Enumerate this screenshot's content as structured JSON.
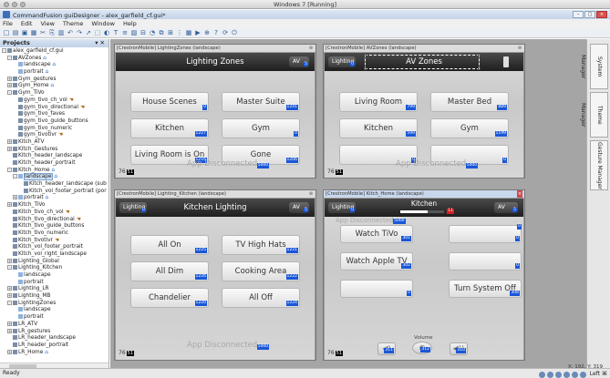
{
  "vm_title": "Windows 7 [Running]",
  "app_title": "CommandFusion guiDesigner - alex_garfield_cf.gui*",
  "menu": [
    "File",
    "Edit",
    "View",
    "Theme",
    "Window",
    "Help"
  ],
  "toolbar_icons": [
    "new",
    "open",
    "save",
    "save-as",
    "cut",
    "copy",
    "paste",
    "undo",
    "redo",
    "pointer",
    "marquee",
    "theme",
    "font",
    "list",
    "image",
    "slider",
    "gauge",
    "arrange",
    "align",
    "distribute",
    "grid",
    "preview",
    "zoom",
    "help",
    "refresh",
    "power"
  ],
  "projects": {
    "header": "Projects",
    "tree": [
      {
        "label": "alex_garfield_cf.gui",
        "indent": 0,
        "ex": "-",
        "icon": "gui"
      },
      {
        "label": "AVZones",
        "indent": 1,
        "ex": "-",
        "icon": "page",
        "badge": "home"
      },
      {
        "label": "landscape",
        "indent": 2,
        "ex": "",
        "icon": "pg",
        "badge": "home"
      },
      {
        "label": "portrait",
        "indent": 2,
        "ex": "",
        "icon": "pg",
        "badge": "home"
      },
      {
        "label": "Gym_gestures",
        "indent": 1,
        "ex": "+",
        "icon": "page"
      },
      {
        "label": "Gym_Home",
        "indent": 1,
        "ex": "+",
        "icon": "page",
        "badge": "home"
      },
      {
        "label": "Gym_TiVo",
        "indent": 1,
        "ex": "-",
        "icon": "page"
      },
      {
        "label": "gym_tivo_ch_vol",
        "indent": 2,
        "ex": "",
        "icon": "sub",
        "badge": "hand"
      },
      {
        "label": "gym_tivo_directional",
        "indent": 2,
        "ex": "",
        "icon": "sub",
        "badge": "hand"
      },
      {
        "label": "gym_tivo_faves",
        "indent": 2,
        "ex": "",
        "icon": "sub"
      },
      {
        "label": "gym_tivo_guide_buttons",
        "indent": 2,
        "ex": "",
        "icon": "sub"
      },
      {
        "label": "gym_tivo_numeric",
        "indent": 2,
        "ex": "",
        "icon": "sub"
      },
      {
        "label": "gym_tivotivr",
        "indent": 2,
        "ex": "",
        "icon": "sub",
        "badge": "hand"
      },
      {
        "label": "Kitch_ATV",
        "indent": 1,
        "ex": "+",
        "icon": "page"
      },
      {
        "label": "Kitch_Gestures",
        "indent": 1,
        "ex": "+",
        "icon": "page"
      },
      {
        "label": "Kitch_header_landscape",
        "indent": 1,
        "ex": "",
        "icon": "sub"
      },
      {
        "label": "Kitch_header_portrait",
        "indent": 1,
        "ex": "",
        "icon": "sub"
      },
      {
        "label": "Kitch_Home",
        "indent": 1,
        "ex": "-",
        "icon": "page",
        "badge": "home"
      },
      {
        "label": "landscape",
        "indent": 2,
        "ex": "-",
        "icon": "pg",
        "badge": "home",
        "selected": true
      },
      {
        "label": "Kitch_header_landscape (sub",
        "indent": 3,
        "ex": "",
        "icon": "sub"
      },
      {
        "label": "Kitch_vol_footer_portrait (por",
        "indent": 3,
        "ex": "",
        "icon": "sub"
      },
      {
        "label": "portrait",
        "indent": 2,
        "ex": "+",
        "icon": "pg",
        "badge": "home"
      },
      {
        "label": "Kitch_TiVo",
        "indent": 1,
        "ex": "+",
        "icon": "page"
      },
      {
        "label": "Kitch_tivo_ch_vol",
        "indent": 1,
        "ex": "",
        "icon": "sub",
        "badge": "hand"
      },
      {
        "label": "Kitch_tivo_directional",
        "indent": 1,
        "ex": "",
        "icon": "sub",
        "badge": "hand"
      },
      {
        "label": "Kitch_tivo_guide_buttons",
        "indent": 1,
        "ex": "",
        "icon": "sub"
      },
      {
        "label": "Kitch_tivo_numeric",
        "indent": 1,
        "ex": "",
        "icon": "sub"
      },
      {
        "label": "Kitch_tivotivr",
        "indent": 1,
        "ex": "",
        "icon": "sub",
        "badge": "hand"
      },
      {
        "label": "Kitch_vol_footer_portrait",
        "indent": 1,
        "ex": "",
        "icon": "sub"
      },
      {
        "label": "Kitch_vol_right_landscape",
        "indent": 1,
        "ex": "",
        "icon": "sub"
      },
      {
        "label": "Lighting_Global",
        "indent": 1,
        "ex": "+",
        "icon": "page"
      },
      {
        "label": "Lighting_Kitchen",
        "indent": 1,
        "ex": "-",
        "icon": "page"
      },
      {
        "label": "landscape",
        "indent": 2,
        "ex": "",
        "icon": "pg"
      },
      {
        "label": "portrait",
        "indent": 2,
        "ex": "",
        "icon": "pg"
      },
      {
        "label": "Lighting_LR",
        "indent": 1,
        "ex": "+",
        "icon": "page"
      },
      {
        "label": "Lighting_MB",
        "indent": 1,
        "ex": "+",
        "icon": "page"
      },
      {
        "label": "LightingZones",
        "indent": 1,
        "ex": "-",
        "icon": "page"
      },
      {
        "label": "landscape",
        "indent": 2,
        "ex": "",
        "icon": "pg"
      },
      {
        "label": "portrait",
        "indent": 2,
        "ex": "",
        "icon": "pg"
      },
      {
        "label": "LR_ATV",
        "indent": 1,
        "ex": "+",
        "icon": "page"
      },
      {
        "label": "LR_gestures",
        "indent": 1,
        "ex": "+",
        "icon": "page"
      },
      {
        "label": "LR_header_landscape",
        "indent": 1,
        "ex": "",
        "icon": "sub"
      },
      {
        "label": "LR_header_portrait",
        "indent": 1,
        "ex": "",
        "icon": "sub"
      },
      {
        "label": "LR_Home",
        "indent": 1,
        "ex": "+",
        "icon": "page",
        "badge": "home"
      }
    ]
  },
  "right_tabs": [
    "System Manager",
    "Theme Manager",
    "Gesture Manager"
  ],
  "panels": {
    "lighting_zones": {
      "title": "[CrestronMobile] LightingZones (landscape)",
      "close": "⊗",
      "header_title": "Lighting Zones",
      "av_pill": "AV",
      "av_join": "5",
      "buttons": [
        {
          "label": "House Scenes",
          "join": "0"
        },
        {
          "label": "Master Suite",
          "join": "1241"
        },
        {
          "label": "Kitchen",
          "join": "1227"
        },
        {
          "label": "Gym",
          "join": "0"
        },
        {
          "label": "Living Room is On",
          "join": "1216"
        },
        {
          "label": "Gone",
          "join": "1206"
        }
      ],
      "footer_text": "App Disconnected",
      "footer_join": "5000",
      "page_num": "76",
      "page_key": "51"
    },
    "av_zones": {
      "title": "[CrestronMobile] AVZones (landscape)",
      "close": "⊗",
      "header_title": "AV Zones",
      "lighting_pill": "Lighting",
      "lighting_join": "0",
      "buttons": [
        {
          "label": "Living Room",
          "join": "799"
        },
        {
          "label": "Master Bed",
          "join": "889"
        },
        {
          "label": "Kitchen",
          "join": "599"
        },
        {
          "label": "Gym",
          "join": "1199"
        },
        {
          "label": "",
          "join": "0"
        },
        {
          "label": "",
          "join": "0"
        }
      ],
      "footer_text": "App Disconnected",
      "footer_join": "5000",
      "page_num": "76",
      "page_key": "51"
    },
    "lighting_kitchen": {
      "title": "[CrestronMobile] Lighting_Kitchen (landscape)",
      "close": "⊗",
      "header_title": "Kitchen Lighting",
      "lighting_pill": "Lighting",
      "lighting_join": "0",
      "av_pill": "AV",
      "av_join": "5",
      "buttons": [
        {
          "label": "All On",
          "join": "1225"
        },
        {
          "label": "TV High Hats",
          "join": "1221"
        },
        {
          "label": "All Dim",
          "join": "1226"
        },
        {
          "label": "Cooking Area",
          "join": "1222"
        },
        {
          "label": "Chandelier",
          "join": "1220"
        },
        {
          "label": "All Off",
          "join": "1224"
        }
      ],
      "footer_text": "App Disconnected",
      "footer_join": "5000",
      "page_num": "76",
      "page_key": "51"
    },
    "kitch_home": {
      "title": "[CrestronMobile] Kitch_Home (landscape)",
      "close": "×",
      "header_title": "Kitchen",
      "lighting_pill": "Lighting",
      "lighting_join": "0",
      "av_pill": "AV",
      "av_join": "5",
      "slider_join": "11",
      "slider_level": 0.62,
      "ghost_text": "App Disconnected",
      "ghost_join": "5000",
      "buttons": [
        {
          "label": "Watch TiVo",
          "join": "301"
        },
        {
          "label": "",
          "join": "0"
        },
        {
          "label": "Watch Apple TV",
          "join": "302"
        },
        {
          "label": "",
          "join": "0"
        },
        {
          "label": "",
          "join": "0"
        },
        {
          "label": "Turn System Off",
          "join": "308"
        }
      ],
      "right_top_join": "0",
      "volume_label": "Volume",
      "vol_down": {
        "icon": "speaker-down-icon",
        "join": "311"
      },
      "vol_mute": {
        "icon": "mute-icon",
        "join": "312"
      },
      "vol_up": {
        "icon": "speaker-up-icon",
        "join": "310"
      },
      "page_num": "76",
      "page_key": "51"
    }
  },
  "status": {
    "left": "Ready",
    "coords": "X: 192, Y: 319",
    "tray_right": "Left ⌘"
  }
}
